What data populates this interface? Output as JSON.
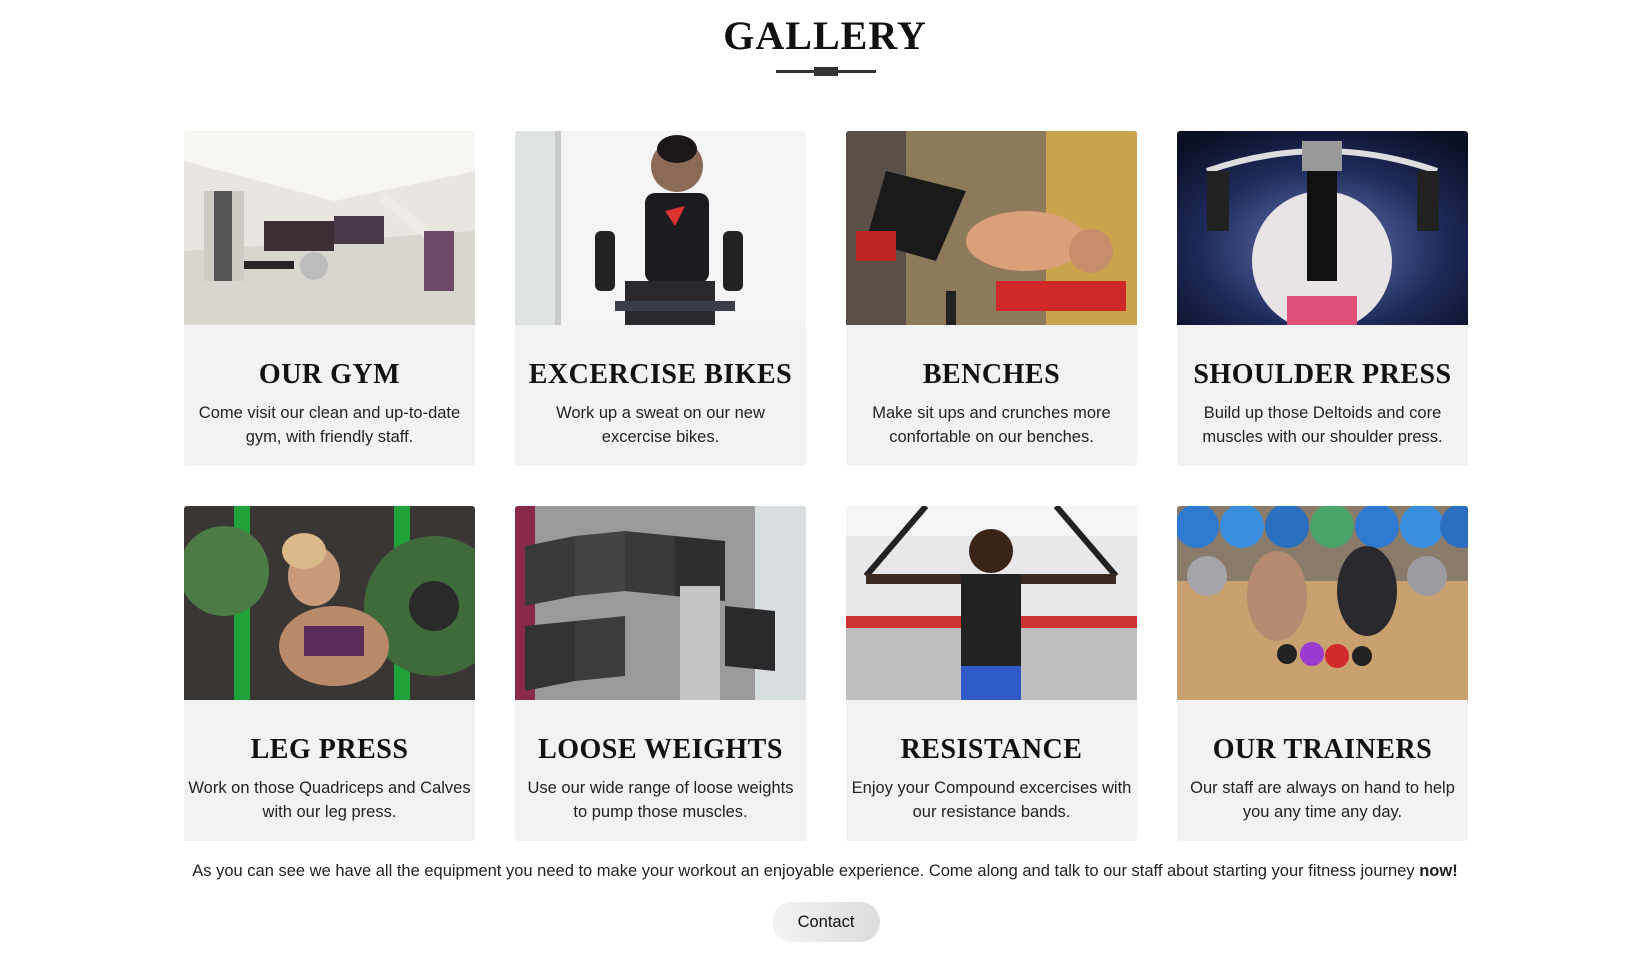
{
  "gallery": {
    "title": "GALLERY"
  },
  "cards": [
    {
      "title": "OUR GYM",
      "description": "Come visit our clean and up-to-date gym, with friendly staff.",
      "image_icon": "gym-interior-photo"
    },
    {
      "title": "EXCERCISE BIKES",
      "description": "Work up a sweat on our new excercise bikes.",
      "image_icon": "exercise-bike-photo"
    },
    {
      "title": "BENCHES",
      "description": "Make sit ups and crunches more confortable on our benches.",
      "image_icon": "bench-situp-photo"
    },
    {
      "title": "SHOULDER PRESS",
      "description": "Build up those Deltoids and core muscles with our shoulder press.",
      "image_icon": "shoulder-press-photo"
    },
    {
      "title": "LEG PRESS",
      "description": "Work on those Quadriceps and Calves with our leg press.",
      "image_icon": "leg-press-photo"
    },
    {
      "title": "LOOSE WEIGHTS",
      "description": "Use our wide range of loose weights to pump those muscles.",
      "image_icon": "dumbbells-photo"
    },
    {
      "title": "RESISTANCE",
      "description": "Enjoy your Compound excercises with our resistance bands.",
      "image_icon": "resistance-bands-photo"
    },
    {
      "title": "OUR TRAINERS",
      "description": "Our staff are always on hand to help you any time any day.",
      "image_icon": "trainers-photo"
    }
  ],
  "footer": {
    "text": "As you can see we have all the equipment you need to make your workout an enjoyable experience. Come along and talk to our staff about starting your fitness journey ",
    "emphasis": "now!"
  },
  "contact_button": {
    "label": "Contact"
  }
}
